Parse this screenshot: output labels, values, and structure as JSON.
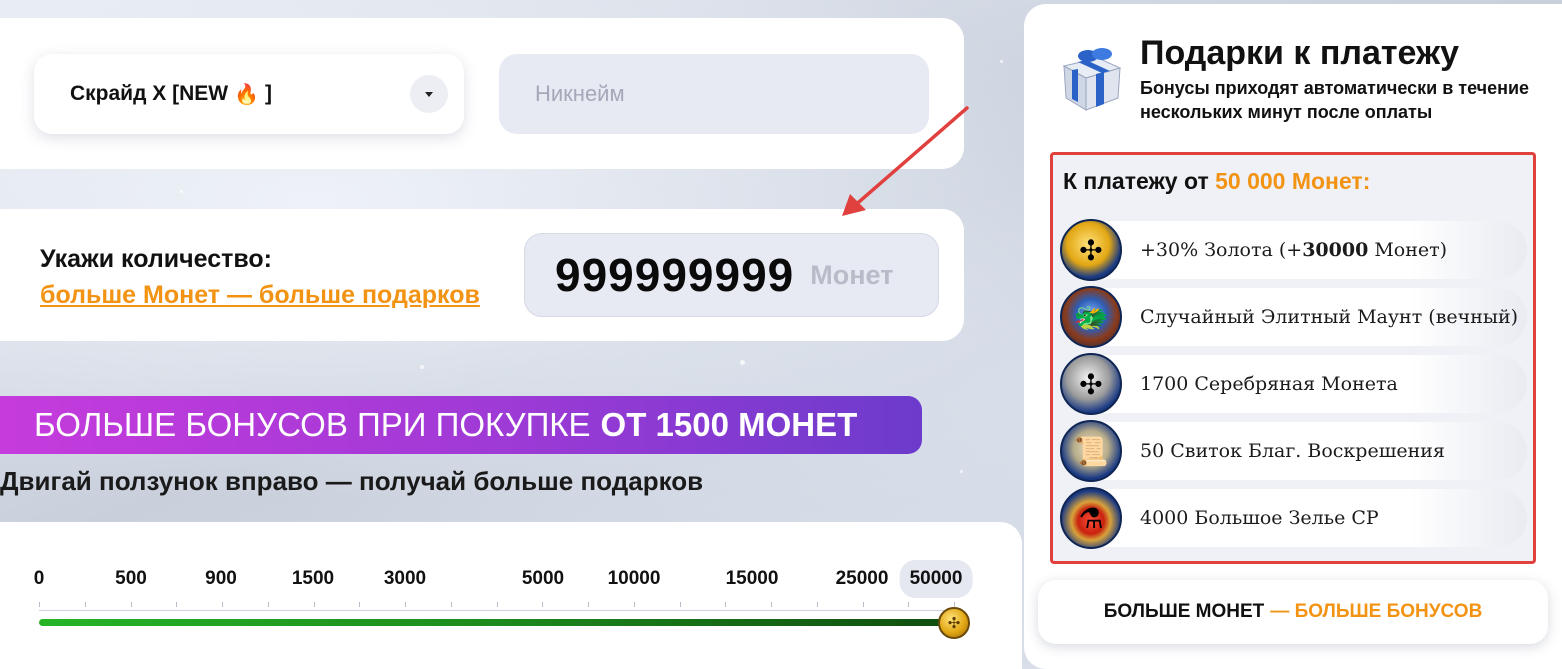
{
  "server": {
    "name": "Скрайд X [NEW",
    "suffix": "]",
    "icon": "fire-icon"
  },
  "nickname": {
    "placeholder": "Никнейм",
    "value": ""
  },
  "quantity": {
    "title": "Укажи количество:",
    "link": "больше Монет — больше подарков",
    "value": "999999999",
    "unit": "Монет"
  },
  "promo": {
    "text": "БОЛЬШЕ БОНУСОВ ПРИ ПОКУПКЕ",
    "strong": "ОТ 1500 МОНЕТ"
  },
  "slider": {
    "hint": "Двигай ползунок вправо — получай больше подарков",
    "ticks": [
      "0",
      "500",
      "900",
      "1500",
      "3000",
      "5000",
      "10000",
      "15000",
      "25000",
      "50000"
    ],
    "selected": "50000",
    "fill_fraction": 1.0
  },
  "gifts": {
    "title": "Подарки к платежу",
    "subtitle": "Бонусы приходят автоматически в течение нескольких минут после оплаты",
    "threshold_label": "К платежу от",
    "threshold_amount": "50 000 Монет:",
    "items": [
      {
        "pre": "+30% Золота (+",
        "bold": "30000",
        "post": " Монет)",
        "icon": "gold-coin-icon"
      },
      {
        "pre": "Случайный Элитный Маунт (вечный)",
        "bold": "",
        "post": "",
        "icon": "elite-mount-icon"
      },
      {
        "pre": "1700 Серебряная Монета",
        "bold": "",
        "post": "",
        "icon": "silver-coin-icon"
      },
      {
        "pre": "50 Свиток Благ. Воскрешения",
        "bold": "",
        "post": "",
        "icon": "scroll-icon"
      },
      {
        "pre": "4000 Большое Зелье CP",
        "bold": "",
        "post": "",
        "icon": "potion-icon"
      }
    ],
    "more_button": {
      "text": "БОЛЬШЕ МОНЕТ",
      "accent": "— БОЛЬШЕ БОНУСОВ"
    }
  },
  "colors": {
    "accent": "#f39313",
    "highlight_border": "#e0413f",
    "banner_start": "#c63bdc",
    "banner_end": "#6c3bcc",
    "slider_fill": "#1c8a1c"
  }
}
